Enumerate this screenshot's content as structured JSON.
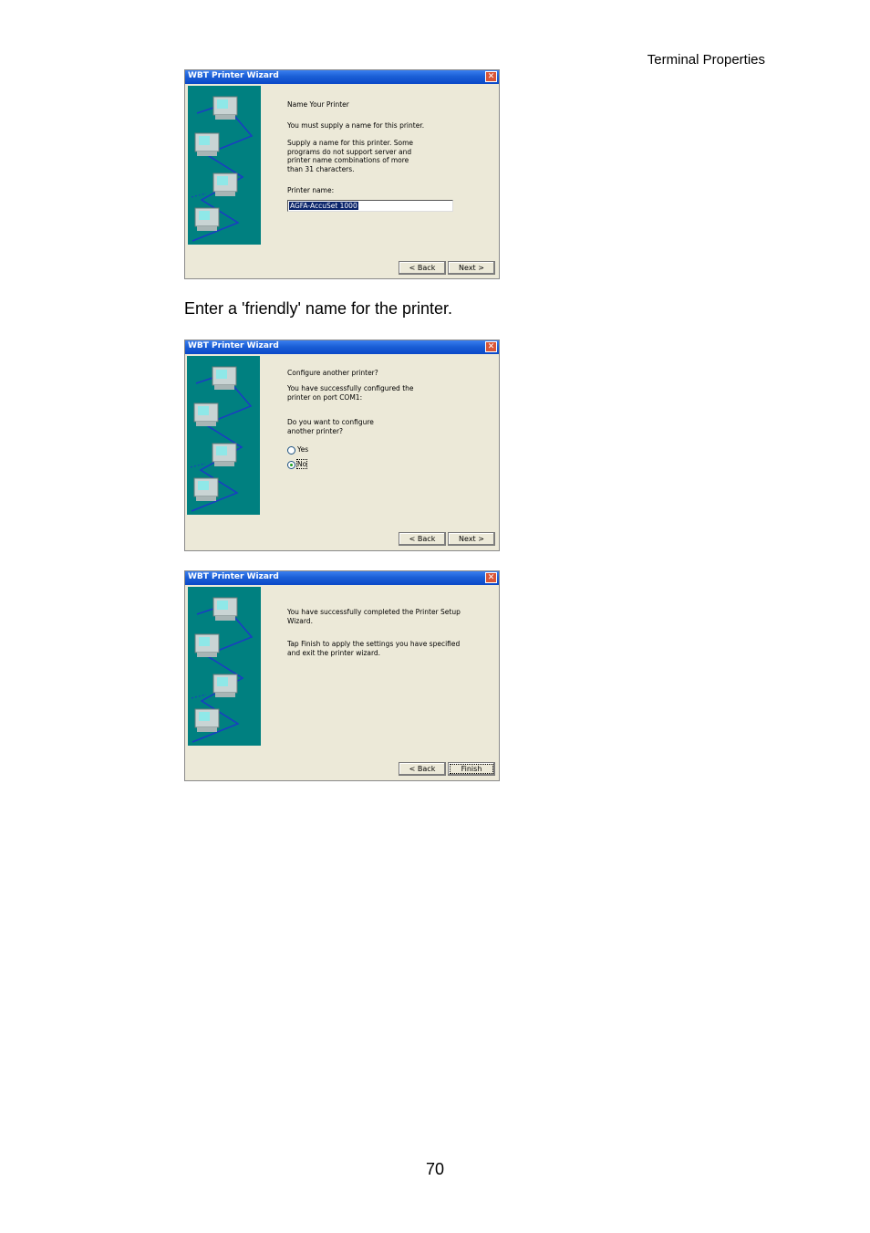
{
  "header": {
    "section_title": "Terminal Properties"
  },
  "caption": "Enter a 'friendly' name for the printer.",
  "page_number": "70",
  "colors": {
    "titlebar": "#0a48c8",
    "art_background": "#008080",
    "dialog_background": "#ece9d8",
    "close_button": "#d95536"
  },
  "dialogs": [
    {
      "title": "WBT Printer Wizard",
      "heading": "Name Your Printer",
      "para1": "You must supply a name for this printer.",
      "para2_lines": [
        "Supply a name for this printer. Some",
        "programs do not support server and",
        "printer name combinations of more",
        "than 31 characters."
      ],
      "field_label": "Printer name:",
      "field_value": "AGFA-AccuSet 1000",
      "back_label": "< Back",
      "next_label": "Next >"
    },
    {
      "title": "WBT Printer Wizard",
      "heading": "Configure another printer?",
      "para1_lines": [
        "You have successfully configured the",
        "printer on port COM1:"
      ],
      "para2_lines": [
        "Do you want to configure",
        "another printer?"
      ],
      "option_yes": "Yes",
      "option_no": "No",
      "selected": "No",
      "back_label": "< Back",
      "next_label": "Next >"
    },
    {
      "title": "WBT Printer Wizard",
      "para1_lines": [
        "You have successfully completed the Printer Setup",
        "Wizard."
      ],
      "para2_lines": [
        "Tap Finish to apply the settings you have specified",
        "and exit the printer wizard."
      ],
      "back_label": "< Back",
      "finish_label": "Finish"
    }
  ]
}
